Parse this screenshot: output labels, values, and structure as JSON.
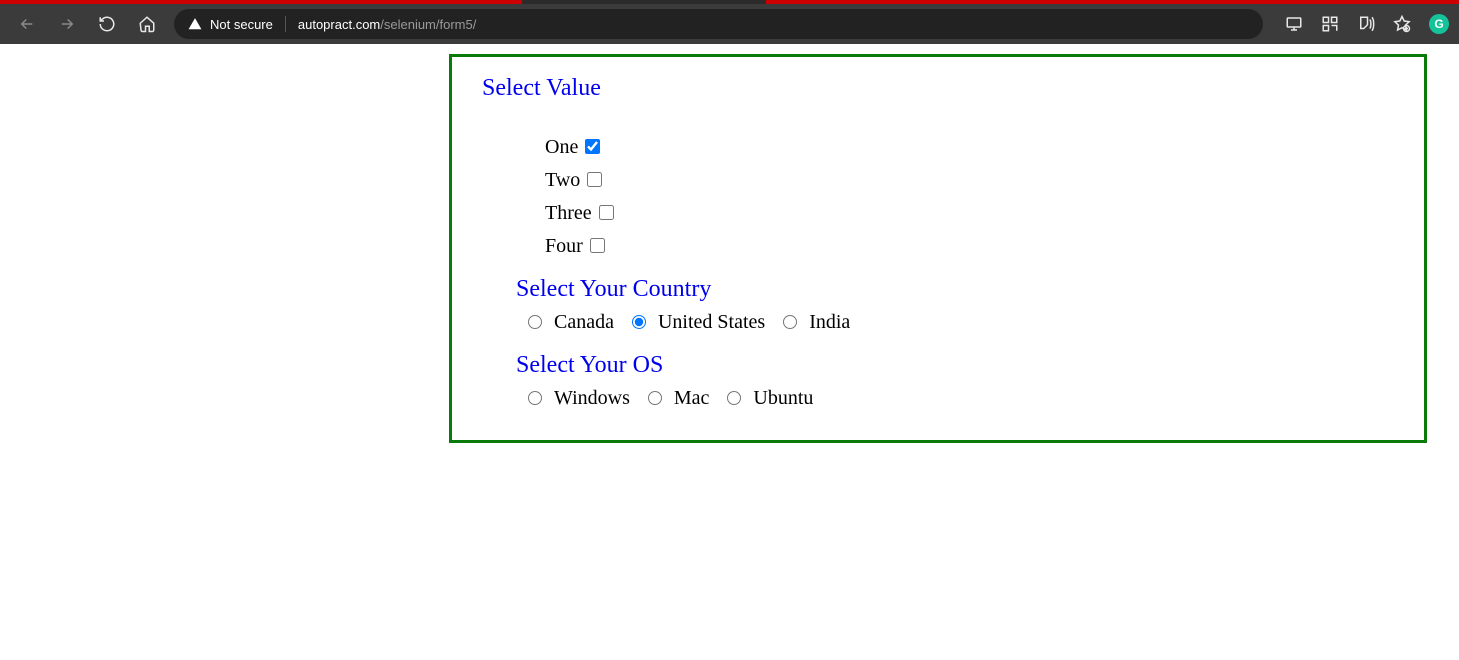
{
  "browser": {
    "not_secure": "Not secure",
    "url_domain": "autopract.com",
    "url_path": "/selenium/form5/"
  },
  "headings": {
    "select_value": "Select Value",
    "select_country": "Select Your Country",
    "select_os": "Select Your OS"
  },
  "checkboxes": {
    "items": [
      {
        "label": "One",
        "checked": true
      },
      {
        "label": "Two",
        "checked": false
      },
      {
        "label": "Three",
        "checked": false
      },
      {
        "label": "Four",
        "checked": false
      }
    ]
  },
  "country": {
    "items": [
      {
        "label": "Canada",
        "checked": false
      },
      {
        "label": "United States",
        "checked": true
      },
      {
        "label": "India",
        "checked": false
      }
    ]
  },
  "os": {
    "items": [
      {
        "label": "Windows",
        "checked": false
      },
      {
        "label": "Mac",
        "checked": false
      },
      {
        "label": "Ubuntu",
        "checked": false
      }
    ]
  }
}
